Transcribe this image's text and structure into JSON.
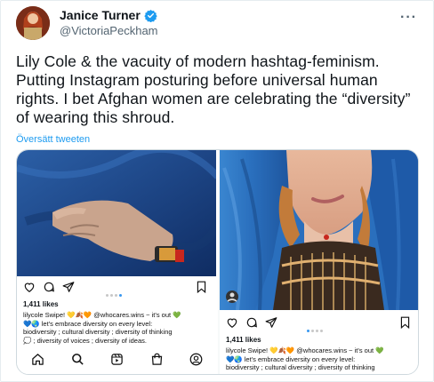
{
  "tweet": {
    "author_name": "Janice Turner",
    "handle": "@VictoriaPeckham",
    "text": "Lily Cole & the vacuity of modern hashtag-feminism. Putting Instagram posturing before universal human rights. I bet Afghan women are celebrating the “diversity” of wearing this shroud.",
    "translate_label": "Översätt tweeten",
    "verified_color": "#1d9bf0",
    "more_icon": "more-dots-icon"
  },
  "instagram_left": {
    "likes": "1,411 likes",
    "caption_lines": [
      "lilycole Swipe! 💛🍂🧡 @whocares.wins ~ it's out 💚",
      "💙🌏 let's embrace diversity on every level:",
      "biodiversity ; cultural diversity ; diversity of thinking",
      "💭 ; diversity of voices ; diversity of ideas."
    ],
    "carousel_active": 3,
    "carousel_count": 4,
    "icons": [
      "heart-icon",
      "comment-icon",
      "share-icon",
      "bookmark-icon"
    ],
    "nav_icons": [
      "home-icon",
      "search-icon",
      "reels-icon",
      "shop-icon",
      "profile-icon"
    ]
  },
  "instagram_right": {
    "likes": "1,411 likes",
    "caption_lines": [
      "lilycole Swipe! 💛🍂🧡 @whocares.wins ~ it's out 💚",
      "💙🌏 let's embrace diversity on every level:",
      "biodiversity ; cultural diversity ; diversity of thinking"
    ],
    "carousel_active": 1,
    "carousel_count": 4,
    "icons": [
      "heart-icon",
      "comment-icon",
      "share-icon",
      "bookmark-icon"
    ]
  },
  "colors": {
    "link": "#1d9bf0",
    "secondary_text": "#536471",
    "burqa_blue": "#1e4f8f"
  }
}
